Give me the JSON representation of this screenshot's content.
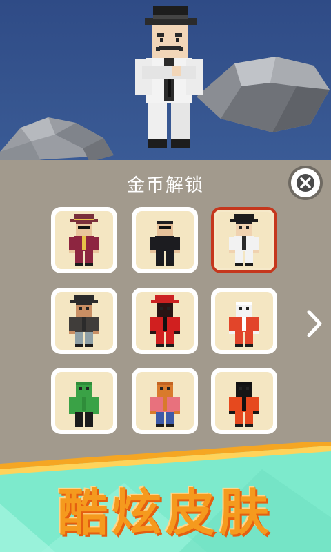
{
  "panel": {
    "title": "金币解锁"
  },
  "skins": [
    {
      "name": "pimp",
      "selected": false,
      "hair": "#7a2f3b",
      "hat": "#7a2f3b",
      "hat_band": "#e7c248",
      "skin": "#e9c59d",
      "top": "#8d2540",
      "bottom": "#8d2540",
      "accent": "#e7c248",
      "shades": true
    },
    {
      "name": "agent",
      "selected": false,
      "hair": "#1f1f22",
      "hat": null,
      "skin": "#e7c29a",
      "top": "#1c1c20",
      "bottom": "#1c1c20",
      "accent": "#1c1c20",
      "shades": true
    },
    {
      "name": "gangster",
      "selected": true,
      "hair": "#1f1f22",
      "hat": "#1c1c1c",
      "skin": "#f0d2b0",
      "top": "#f2f2f2",
      "bottom": "#f2f2f2",
      "accent": "#2a2a2a",
      "shades": false
    },
    {
      "name": "bandit",
      "selected": false,
      "hair": "#2b2b2b",
      "hat": "#2b2b2b",
      "skin": "#c98f64",
      "top": "#403d3a",
      "bottom": "#8fa0a6",
      "accent": "#2b2b2b",
      "shades": false
    },
    {
      "name": "ninja",
      "selected": false,
      "hair": "#2a1414",
      "hat": "#cc2222",
      "skin": "#2a1414",
      "top": "#d11f1f",
      "bottom": "#d11f1f",
      "accent": "#111111",
      "shades": false
    },
    {
      "name": "mummy",
      "selected": false,
      "hair": "#ffffff",
      "hat": null,
      "skin": "#f3f3f3",
      "top": "#e2452a",
      "bottom": "#e2452a",
      "accent": "#ffffff",
      "shades": false
    },
    {
      "name": "cactus",
      "selected": false,
      "hair": "#2f8d3a",
      "hat": null,
      "skin": "#3aa246",
      "top": "#3aa246",
      "bottom": "#1b1b1b",
      "accent": "#2f8d3a",
      "shades": false
    },
    {
      "name": "pumpkin",
      "selected": false,
      "hair": "#c46422",
      "hat": null,
      "skin": "#d97a2c",
      "top": "#e8717d",
      "bottom": "#3d5aa8",
      "accent": "#d97a2c",
      "shades": false
    },
    {
      "name": "venom",
      "selected": false,
      "hair": "#111111",
      "hat": null,
      "skin": "#151515",
      "top": "#e6491e",
      "bottom": "#e6491e",
      "accent": "#111111",
      "shades": false
    }
  ],
  "banner": {
    "text": "酷炫皮肤"
  },
  "colors": {
    "panel": "#a29a8d",
    "cell_bg": "#f4e6c2",
    "selected_border": "#c5371d",
    "banner": "#f59a1e",
    "footer_mint": "#7deacc"
  },
  "icons": {
    "close": "close-icon",
    "next": "chevron-right-icon"
  }
}
